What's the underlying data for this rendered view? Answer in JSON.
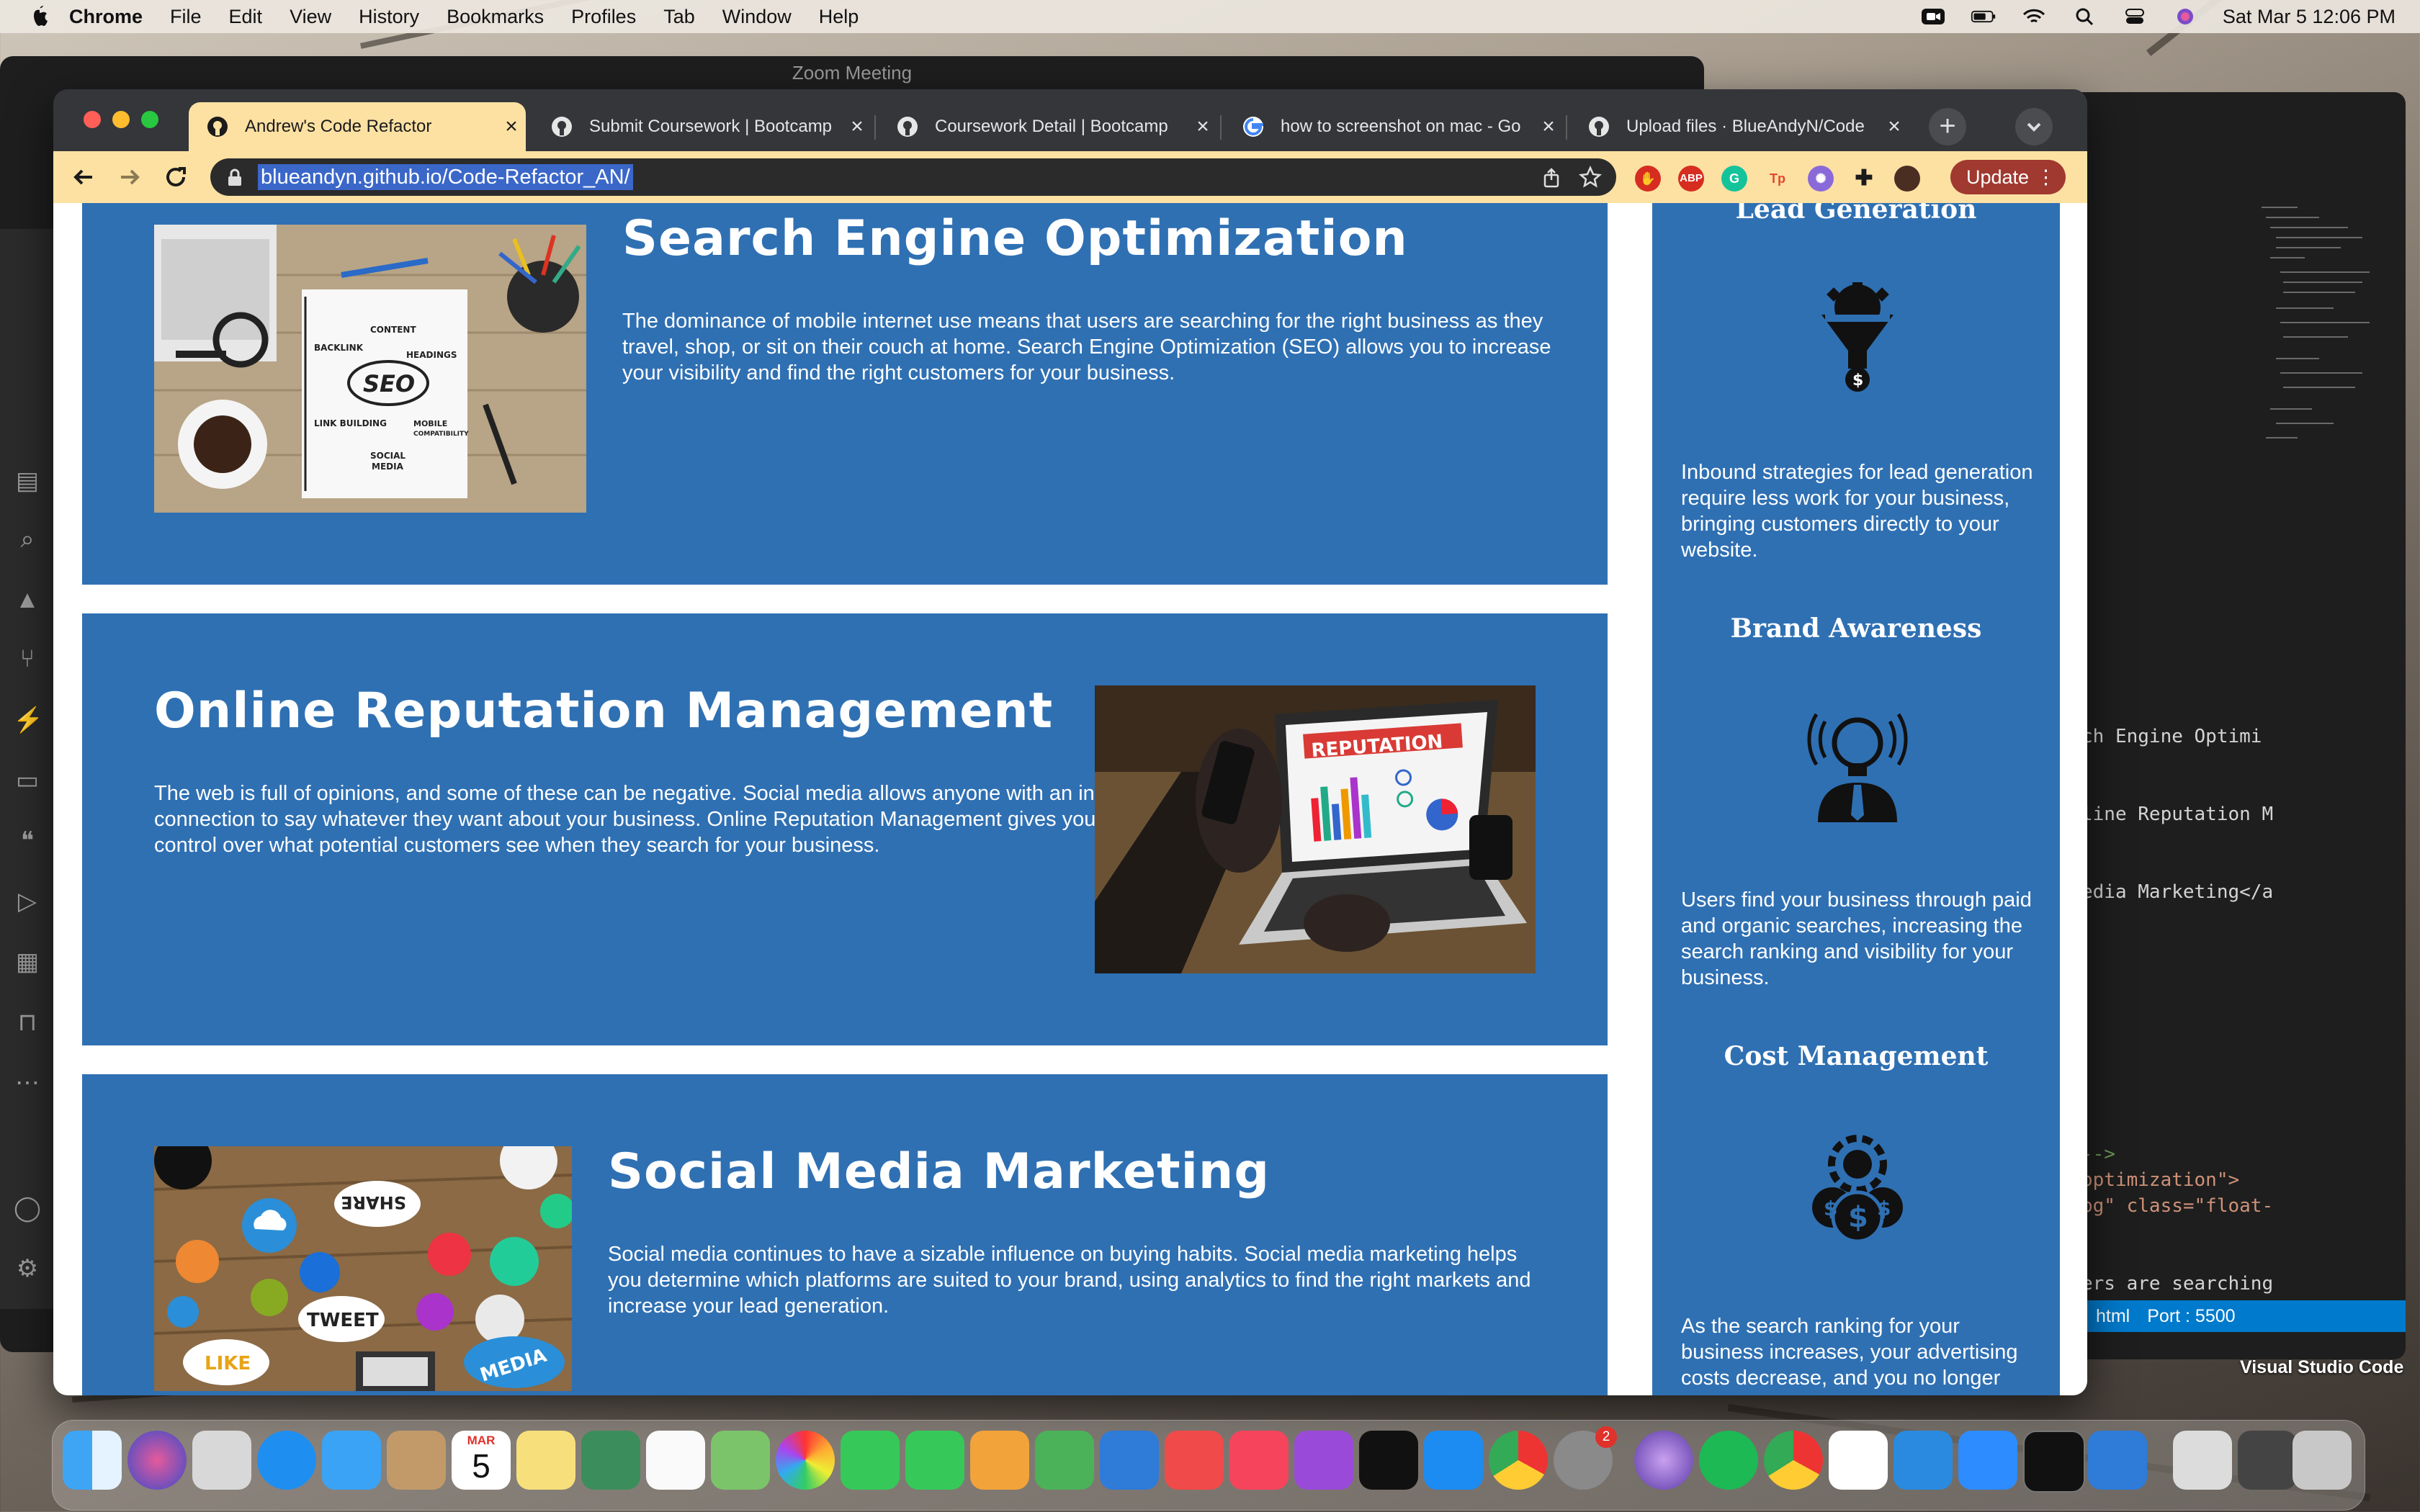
{
  "menubar": {
    "app": "Chrome",
    "items": [
      "File",
      "Edit",
      "View",
      "History",
      "Bookmarks",
      "Profiles",
      "Tab",
      "Window",
      "Help"
    ],
    "clock": "Sat Mar 5  12:06 PM"
  },
  "zoom": {
    "title": "Zoom Meeting"
  },
  "chrome": {
    "tabs": [
      {
        "label": "Andrew's Code Refactor",
        "active": true
      },
      {
        "label": "Submit Coursework | Bootcamp",
        "active": false
      },
      {
        "label": "Coursework Detail | Bootcamp",
        "active": false
      },
      {
        "label": "how to screenshot on mac - Go",
        "active": false
      },
      {
        "label": "Upload files · BlueAndyN/Code",
        "active": false
      }
    ],
    "url": "blueandyn.github.io/Code-Refactor_AN/",
    "update_label": "Update",
    "extensions": [
      "ABP",
      "G",
      "Tp"
    ]
  },
  "page": {
    "sections": [
      {
        "title": "Search Engine Optimization",
        "text": "The dominance of mobile internet use means that users are searching for the right business as they travel, shop, or sit on their couch at home. Search Engine Optimization (SEO) allows you to increase your visibility and find the right customers for your business.",
        "image_words": [
          "CONTENT",
          "BACKLINK",
          "HEADINGS",
          "SEO",
          "LINK BUILDING",
          "MOBILE COMPATIBILITY",
          "SOCIAL MEDIA"
        ]
      },
      {
        "title": "Online Reputation Management",
        "text": "The web is full of opinions, and some of these can be negative. Social media allows anyone with an internet connection to say whatever they want about your business. Online Reputation Management gives you the control over what potential customers see when they search for your business.",
        "image_words": [
          "REPUTATION"
        ]
      },
      {
        "title": "Social Media Marketing",
        "text": "Social media continues to have a sizable influence on buying habits. Social media marketing helps you determine which platforms are suited to your brand, using analytics to find the right markets and increase your lead generation.",
        "image_words": [
          "SHARE",
          "TWEET",
          "LIKE",
          "MEDIA"
        ]
      }
    ],
    "benefits": [
      {
        "title": "Lead Generation",
        "icon": "funnel-gear-icon",
        "text": "Inbound strategies for lead generation require less work for your business, bringing customers directly to your website."
      },
      {
        "title": "Brand Awareness",
        "icon": "lightbulb-person-icon",
        "text": "Users find your business through paid and organic searches, increasing the search ranking and visibility for your business."
      },
      {
        "title": "Cost Management",
        "icon": "gear-money-icon",
        "text": "As the search ranking for your business increases, your advertising costs decrease, and you no longer"
      }
    ]
  },
  "vscode": {
    "code_lines": [
      "ch Engine Optimi",
      "line Reputation M",
      "edia Marketing</a",
      "-->",
      "optimization\">",
      "pg\" class=\"float-",
      "ers are searching"
    ],
    "status": {
      "lang": "html",
      "port": "Port : 5500"
    },
    "label": "Visual Studio Code"
  },
  "dock": {
    "calendar_month": "MAR",
    "calendar_day": "5",
    "badge": "2"
  },
  "colors": {
    "panel_blue": "#2f70b3",
    "tab_active": "#fde1a3",
    "update_button": "#a0392f"
  }
}
